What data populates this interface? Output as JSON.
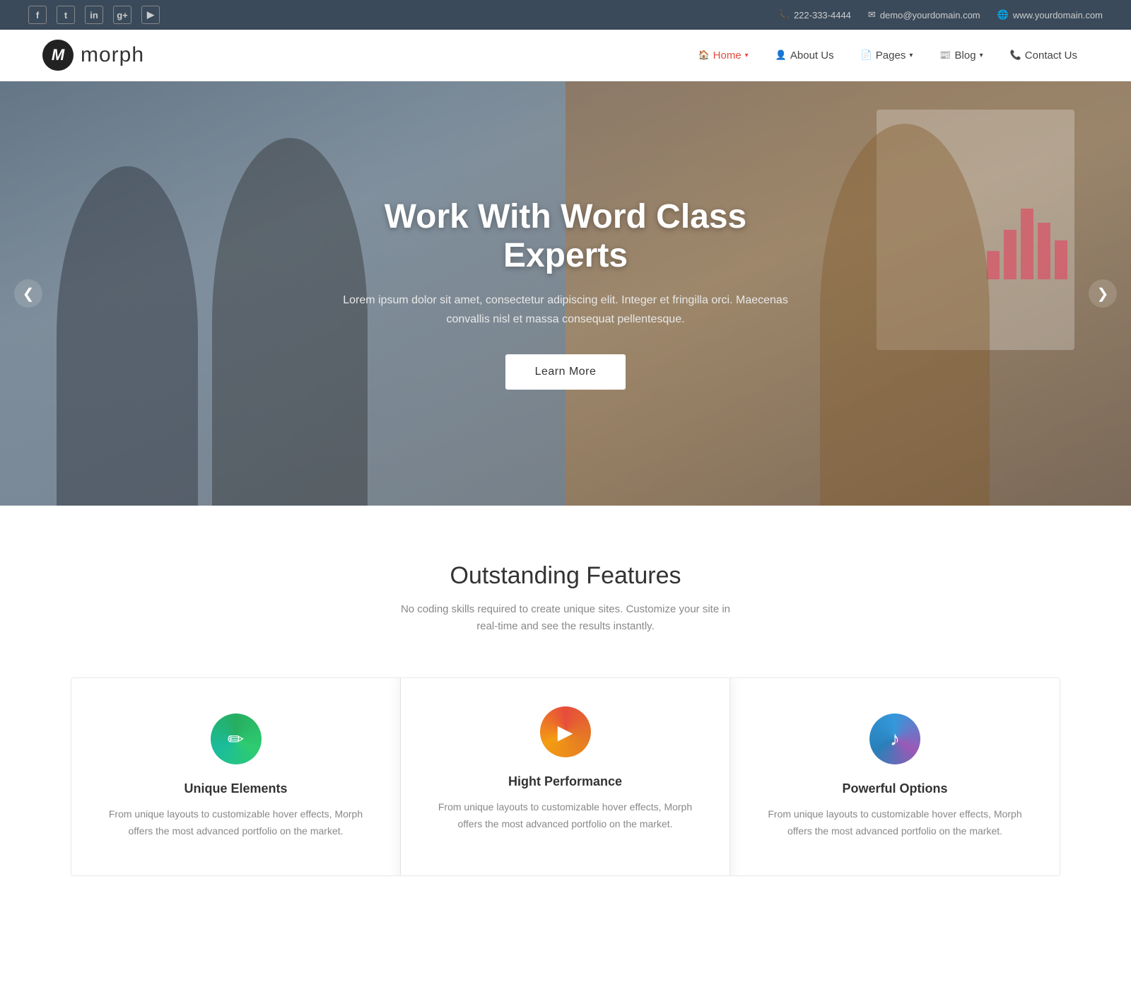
{
  "topbar": {
    "phone": "222-333-4444",
    "email": "demo@yourdomain.com",
    "website": "www.yourdomain.com",
    "socials": [
      "f",
      "t",
      "in",
      "g+",
      "▶"
    ]
  },
  "header": {
    "logo_letter": "M",
    "logo_text": "morph",
    "nav": [
      {
        "label": "Home",
        "icon": "🏠",
        "active": true,
        "has_dropdown": true
      },
      {
        "label": "About Us",
        "icon": "👤",
        "active": false,
        "has_dropdown": false
      },
      {
        "label": "Pages",
        "icon": "📄",
        "active": false,
        "has_dropdown": true
      },
      {
        "label": "Blog",
        "icon": "📰",
        "active": false,
        "has_dropdown": true
      },
      {
        "label": "Contact Us",
        "icon": "📞",
        "active": false,
        "has_dropdown": false
      }
    ]
  },
  "hero": {
    "title": "Work With Word Class Experts",
    "description": "Lorem ipsum dolor sit amet, consectetur adipiscing elit. Integer et fringilla orci. Maecenas convallis nisl et massa consequat pellentesque.",
    "cta_label": "Learn More",
    "arrow_left": "❮",
    "arrow_right": "❯"
  },
  "features": {
    "title": "Outstanding Features",
    "subtitle": "No coding skills required to create unique sites. Customize your site in real-time and see the results instantly.",
    "cards": [
      {
        "icon": "✏",
        "icon_style": "green",
        "name": "Unique Elements",
        "description": "From unique layouts to customizable hover effects, Morph offers the most advanced portfolio on the market."
      },
      {
        "icon": "▶",
        "icon_style": "red",
        "name": "Hight Performance",
        "description": "From unique layouts to customizable hover effects, Morph offers the most advanced portfolio on the market."
      },
      {
        "icon": "♪",
        "icon_style": "blue",
        "name": "Powerful Options",
        "description": "From unique layouts to customizable hover effects, Morph offers the most advanced portfolio on the market."
      }
    ]
  }
}
